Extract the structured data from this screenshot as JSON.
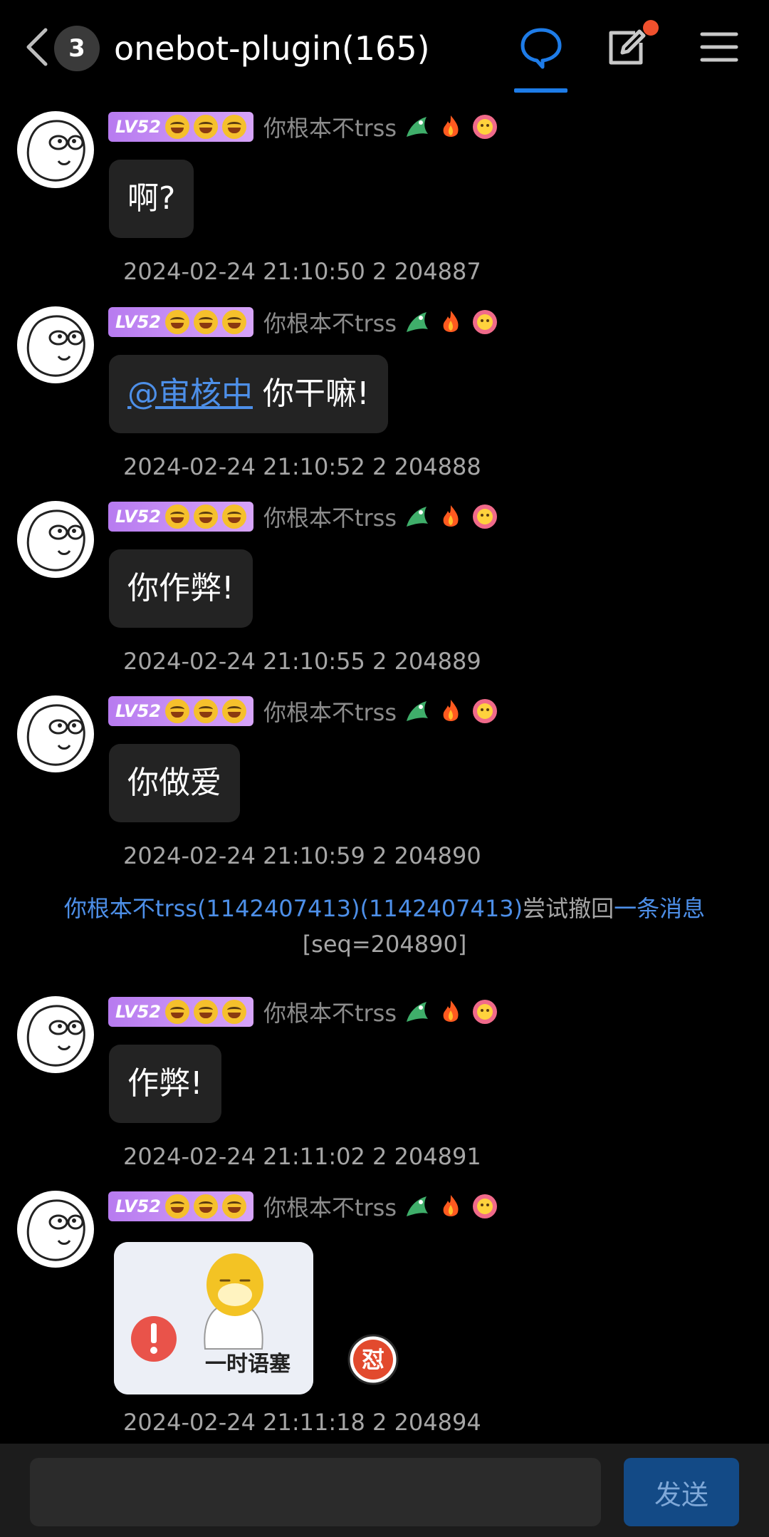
{
  "header": {
    "unread_count": "3",
    "title": "onebot-plugin(165)"
  },
  "colors": {
    "accent_blue": "#1e7ce8",
    "link_blue": "#4d8fe8",
    "level_badge": "#c18af3",
    "notification_dot": "#f0502d",
    "send_button": "#134a86"
  },
  "sender": {
    "level": "LV52",
    "nickname": "你根本不trss"
  },
  "messages": [
    {
      "text": "啊?",
      "stamp": "2024-02-24 21:10:50 2 204887"
    },
    {
      "mention": "@审核中",
      "text": "你干嘛!",
      "stamp": "2024-02-24 21:10:52 2 204888"
    },
    {
      "text": "你作弊!",
      "stamp": "2024-02-24 21:10:55 2 204889"
    },
    {
      "text": "你做爱",
      "stamp": "2024-02-24 21:10:59 2 204890"
    },
    {
      "text": "作弊!",
      "stamp": "2024-02-24 21:11:02 2 204891"
    },
    {
      "sticker_caption": "一时语塞",
      "reaction_icon": "怼",
      "stamp": "2024-02-24 21:11:18 2 204894"
    }
  ],
  "recall_notice": {
    "who": "你根本不trss(1142407413)(1142407413)",
    "action": "尝试撤回",
    "target": "一条消息",
    "seq": "[seq=204890]"
  },
  "input": {
    "placeholder": "",
    "send_label": "发送"
  }
}
